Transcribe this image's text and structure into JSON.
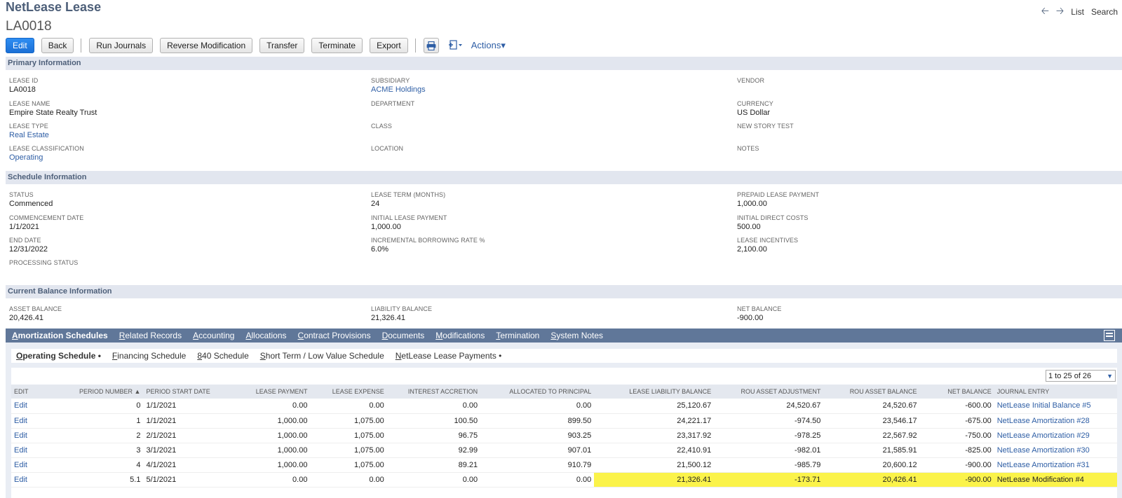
{
  "page": {
    "title": "NetLease Lease",
    "record_id": "LA0018"
  },
  "topnav": {
    "back_icon": "arrow-left-icon",
    "forward_icon": "arrow-right-icon",
    "list_label": "List",
    "search_label": "Search"
  },
  "toolbar": {
    "edit": "Edit",
    "back": "Back",
    "run_journals": "Run Journals",
    "reverse_modification": "Reverse Modification",
    "transfer": "Transfer",
    "terminate": "Terminate",
    "export": "Export",
    "actions": "Actions"
  },
  "primary": {
    "header": "Primary Information",
    "fields": [
      {
        "label": "Lease ID",
        "value": "LA0018"
      },
      {
        "label": "Lease Name",
        "value": "Empire State Realty Trust"
      },
      {
        "label": "Lease Type",
        "value": "Real Estate"
      },
      {
        "label": "Lease Classification",
        "value": "Operating"
      },
      {
        "label": "Subsidiary",
        "value": "ACME Holdings"
      },
      {
        "label": "Department",
        "value": ""
      },
      {
        "label": "Class",
        "value": ""
      },
      {
        "label": "Location",
        "value": ""
      },
      {
        "label": "Vendor",
        "value": ""
      },
      {
        "label": "Currency",
        "value": "US Dollar"
      },
      {
        "label": "New Story Test",
        "value": ""
      },
      {
        "label": "Notes",
        "value": ""
      }
    ]
  },
  "schedule": {
    "header": "Schedule Information",
    "fields": [
      {
        "label": "Status",
        "value": "Commenced"
      },
      {
        "label": "Commencement Date",
        "value": "1/1/2021"
      },
      {
        "label": "End Date",
        "value": "12/31/2022"
      },
      {
        "label": "Processing Status",
        "value": ""
      },
      {
        "label": "Lease Term (Months)",
        "value": "24"
      },
      {
        "label": "Initial Lease Payment",
        "value": "1,000.00"
      },
      {
        "label": "Incremental Borrowing Rate %",
        "value": "6.0%"
      },
      {
        "label": "Prepaid Lease Payment",
        "value": "1,000.00"
      },
      {
        "label": "Initial Direct Costs",
        "value": "500.00"
      },
      {
        "label": "Lease Incentives",
        "value": "2,100.00"
      }
    ]
  },
  "balance": {
    "header": "Current Balance Information",
    "fields": [
      {
        "label": "Asset Balance",
        "value": "20,426.41"
      },
      {
        "label": "Liability Balance",
        "value": "21,326.41"
      },
      {
        "label": "Net Balance",
        "value": "-900.00"
      }
    ]
  },
  "tabs": [
    {
      "first": "A",
      "rest": "mortization Schedules"
    },
    {
      "first": "R",
      "rest": "elated Records"
    },
    {
      "first": "A",
      "rest": "ccounting"
    },
    {
      "first": "A",
      "rest": "llocations"
    },
    {
      "first": "C",
      "rest": "ontract Provisions"
    },
    {
      "first": "D",
      "rest": "ocuments"
    },
    {
      "first": "M",
      "rest": "odifications"
    },
    {
      "first": "T",
      "rest": "ermination"
    },
    {
      "first": "S",
      "rest": "ystem Notes"
    }
  ],
  "subtabs": [
    {
      "first": "O",
      "rest": "perating Schedule •"
    },
    {
      "first": "F",
      "rest": "inancing Schedule"
    },
    {
      "first": "8",
      "rest": "40 Schedule"
    },
    {
      "first": "S",
      "rest": "hort Term / Low Value Schedule"
    },
    {
      "first": "N",
      "rest": "etLease Lease Payments •"
    }
  ],
  "pager": "1 to 25 of 26",
  "table": {
    "headers": [
      "Edit",
      "Period Number ▲",
      "Period Start Date",
      "Lease Payment",
      "Lease Expense",
      "Interest Accretion",
      "Allocated to Principal",
      "Lease Liability Balance",
      "ROU Asset Adjustment",
      "ROU Asset Balance",
      "Net Balance",
      "Journal Entry"
    ],
    "rows": [
      [
        "Edit",
        "0",
        "1/1/2021",
        "0.00",
        "0.00",
        "0.00",
        "0.00",
        "25,120.67",
        "24,520.67",
        "24,520.67",
        "-600.00",
        "NetLease Initial Balance #5"
      ],
      [
        "Edit",
        "1",
        "1/1/2021",
        "1,000.00",
        "1,075.00",
        "100.50",
        "899.50",
        "24,221.17",
        "-974.50",
        "23,546.17",
        "-675.00",
        "NetLease Amortization #28"
      ],
      [
        "Edit",
        "2",
        "2/1/2021",
        "1,000.00",
        "1,075.00",
        "96.75",
        "903.25",
        "23,317.92",
        "-978.25",
        "22,567.92",
        "-750.00",
        "NetLease Amortization #29"
      ],
      [
        "Edit",
        "3",
        "3/1/2021",
        "1,000.00",
        "1,075.00",
        "92.99",
        "907.01",
        "22,410.91",
        "-982.01",
        "21,585.91",
        "-825.00",
        "NetLease Amortization #30"
      ],
      [
        "Edit",
        "4",
        "4/1/2021",
        "1,000.00",
        "1,075.00",
        "89.21",
        "910.79",
        "21,500.12",
        "-985.79",
        "20,600.12",
        "-900.00",
        "NetLease Amortization #31"
      ],
      [
        "Edit",
        "5.1",
        "5/1/2021",
        "0.00",
        "0.00",
        "0.00",
        "0.00",
        "21,326.41",
        "-173.71",
        "20,426.41",
        "-900.00",
        "NetLease Modification #4"
      ]
    ],
    "highlighted_row": 5,
    "highlight_color": "#fbf34a"
  },
  "colors": {
    "header_text": "#4d5f79",
    "section_bg": "#e2e6ef",
    "tab_bar": "#607799",
    "link": "#2e5ea5",
    "primary_button": "#1a6fd6"
  }
}
